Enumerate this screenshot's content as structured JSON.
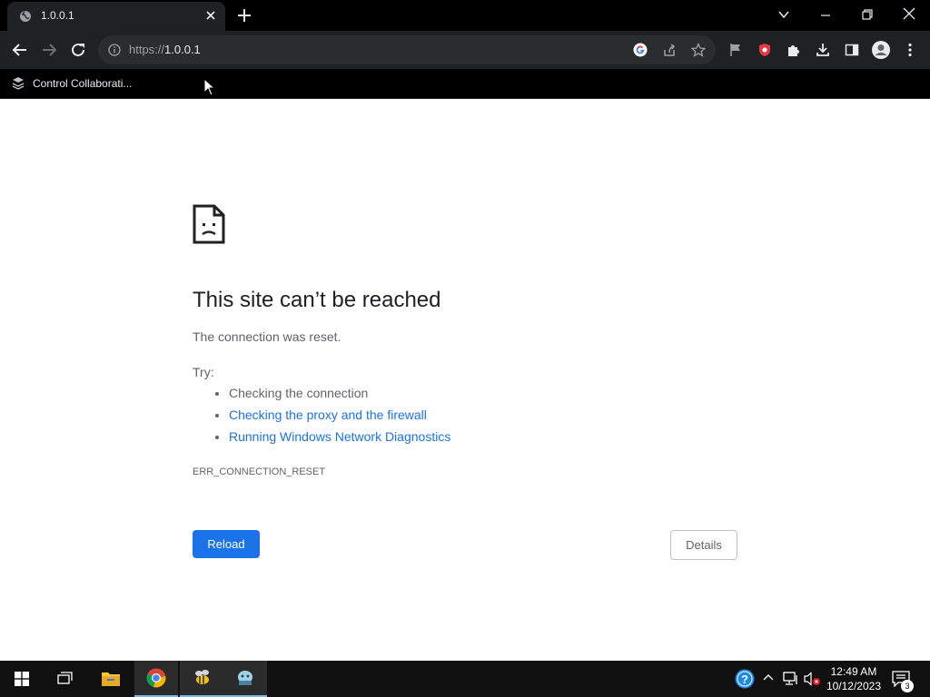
{
  "browser": {
    "tab_title": "1.0.0.1",
    "url_scheme": "https://",
    "url_host": "1.0.0.1",
    "bookmark_label": "Control Collaborati..."
  },
  "error_page": {
    "title": "This site can’t be reached",
    "subtitle": "The connection was reset.",
    "try_label": "Try:",
    "suggestions": [
      "Checking the connection",
      "Checking the proxy and the firewall",
      "Running Windows Network Diagnostics"
    ],
    "error_code": "ERR_CONNECTION_RESET",
    "reload_label": "Reload",
    "details_label": "Details"
  },
  "taskbar": {
    "time": "12:49 AM",
    "date": "10/12/2023",
    "notification_count": "3"
  },
  "colors": {
    "link": "#1a73e8",
    "primary_button": "#1a73e8",
    "text_secondary": "#5f6368"
  }
}
